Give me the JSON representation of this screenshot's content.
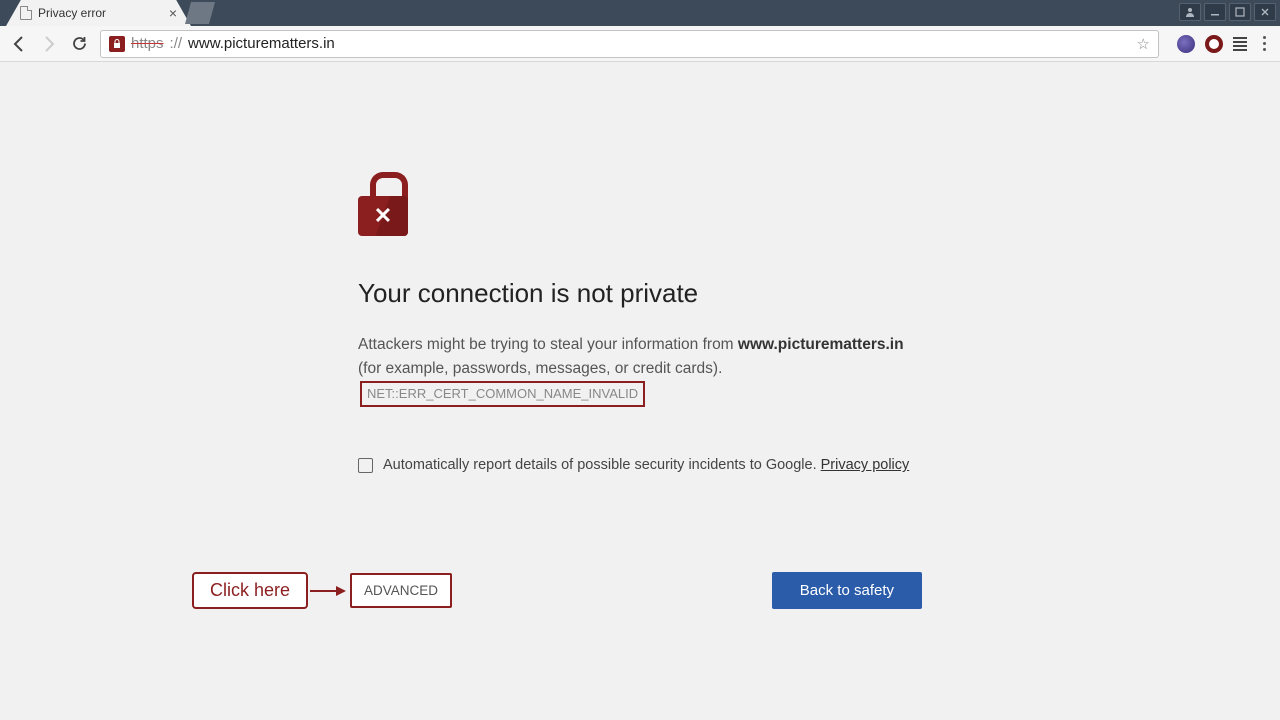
{
  "tab": {
    "title": "Privacy error"
  },
  "url": {
    "protocol": "https",
    "sep": "://",
    "host": "www.picturematters.in"
  },
  "warning": {
    "heading": "Your connection is not private",
    "para_prefix": "Attackers might be trying to steal your information from ",
    "domain": "www.picturematters.in",
    "para_suffix": " (for example, passwords, messages, or credit cards).",
    "error_code": "NET::ERR_CERT_COMMON_NAME_INVALID",
    "checkbox_label": "Automatically report details of possible security incidents to Google. ",
    "privacy_policy": "Privacy policy"
  },
  "annotation": {
    "click_here": "Click here"
  },
  "buttons": {
    "advanced": "ADVANCED",
    "back_to_safety": "Back to safety"
  }
}
